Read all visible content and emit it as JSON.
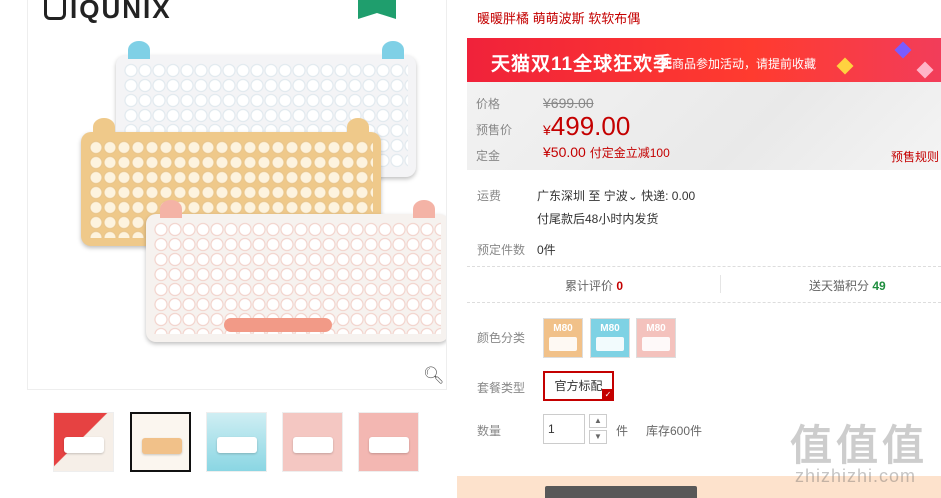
{
  "brand": "IQUNIX",
  "subtitle": "暖暖胖橘 萌萌波斯 软软布偶",
  "promo": {
    "title": "天猫双11全球狂欢季",
    "note": "此商品参加活动，请提前收藏"
  },
  "price": {
    "original_label": "价格",
    "original": "¥699.00",
    "presale_label": "预售价",
    "currency": "¥",
    "presale": "499.00",
    "deposit_label": "定金",
    "deposit": "¥50.00",
    "deposit_note": "付定金立减100",
    "rules_link": "预售规则"
  },
  "shipping": {
    "label": "运费",
    "from": "广东深圳",
    "to_prefix": "至",
    "to": "宁波",
    "express": "快递: 0.00",
    "delivery_note": "付尾款后48小时内发货"
  },
  "reserved": {
    "label": "预定件数",
    "value": "0件"
  },
  "stats": {
    "reviews_label": "累计评价",
    "reviews_count": "0",
    "points_label": "送天猫积分",
    "points": "49"
  },
  "color": {
    "label": "颜色分类",
    "options": [
      "M80",
      "M80",
      "M80"
    ]
  },
  "package": {
    "label": "套餐类型",
    "selected": "官方标配"
  },
  "quantity": {
    "label": "数量",
    "value": "1",
    "unit": "件",
    "stock": "库存600件"
  },
  "watermark": {
    "logo": "值值值",
    "site": "zhizhizhi.com"
  },
  "colors": {
    "accent_red": "#c40000",
    "promo_red": "#ff3b2f",
    "points_green": "#1e8e3e"
  }
}
